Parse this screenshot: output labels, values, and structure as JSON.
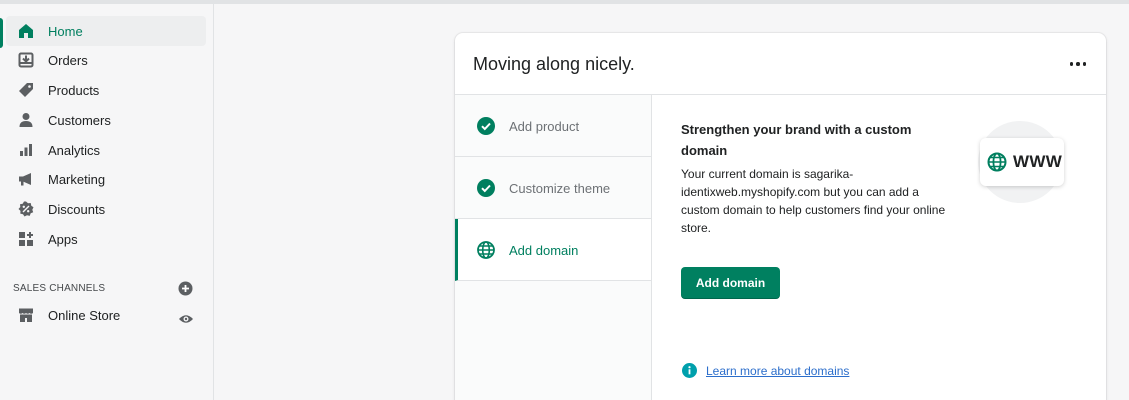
{
  "sidebar": {
    "items": [
      {
        "label": "Home",
        "icon": "home-icon",
        "active": true
      },
      {
        "label": "Orders",
        "icon": "orders-icon"
      },
      {
        "label": "Products",
        "icon": "tag-icon"
      },
      {
        "label": "Customers",
        "icon": "person-icon"
      },
      {
        "label": "Analytics",
        "icon": "bar-chart-icon"
      },
      {
        "label": "Marketing",
        "icon": "megaphone-icon"
      },
      {
        "label": "Discounts",
        "icon": "discount-icon"
      },
      {
        "label": "Apps",
        "icon": "apps-icon"
      }
    ],
    "sales_channels_label": "SALES CHANNELS",
    "channels": [
      {
        "label": "Online Store",
        "icon": "store-icon"
      }
    ]
  },
  "card": {
    "title": "Moving along nicely.",
    "steps": [
      {
        "label": "Add product",
        "status": "complete"
      },
      {
        "label": "Customize theme",
        "status": "complete"
      },
      {
        "label": "Add domain",
        "status": "active"
      }
    ],
    "detail": {
      "heading": "Strengthen your brand with a custom domain",
      "body": "Your current domain is sagarika-identixweb.myshopify.com but you can add a custom domain to help customers find your online store.",
      "button_label": "Add domain",
      "learn_more": "Learn more about domains",
      "illustration_text": "WWW"
    }
  },
  "colors": {
    "accent": "#008060",
    "active_text": "#007f5f",
    "link": "#2c6ecb",
    "background": "#f6f6f7"
  }
}
